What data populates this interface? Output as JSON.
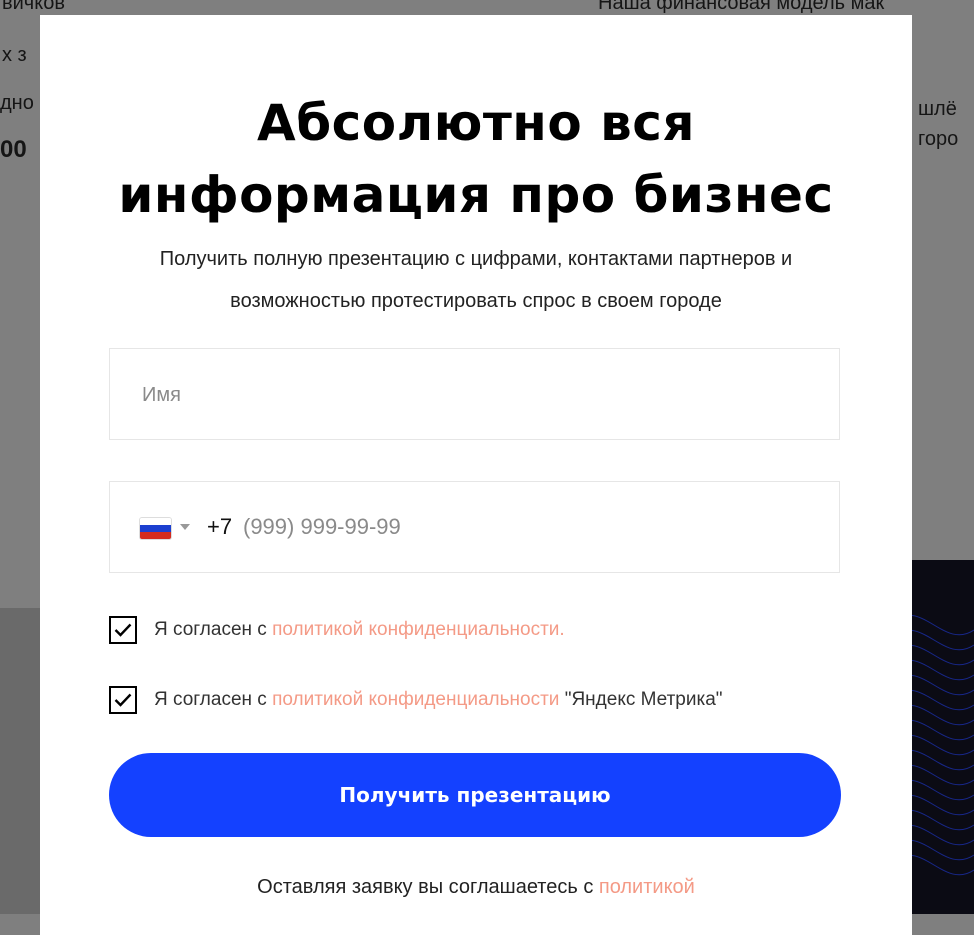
{
  "background": {
    "left_lines": [
      "вичков",
      "х з",
      "дно",
      "00 "
    ],
    "right_lines": [
      "Наша финансовая модель мак",
      "шлё",
      "горо"
    ]
  },
  "modal": {
    "title_line1": "Абсолютно вся",
    "title_line2": "информация про бизнес",
    "subtitle_line1": "Получить полную презентацию с цифрами, контактами партнеров и",
    "subtitle_line2": "возможностью протестировать спрос в своем городе",
    "name_field": {
      "placeholder": "Имя",
      "value": ""
    },
    "phone_field": {
      "country_icon": "russia-flag-icon",
      "dial_code": "+7",
      "placeholder": "(999) 999-99-99"
    },
    "consent1": {
      "checked": true,
      "prefix": "Я согласен с ",
      "link": "политикой конфиденциальности.",
      "suffix": ""
    },
    "consent2": {
      "checked": true,
      "prefix": "Я согласен с ",
      "link": "политикой конфиденциальности",
      "suffix": " \"Яндекс Метрика\""
    },
    "submit_label": "Получить презентацию",
    "footer_prefix": "Оставляя заявку вы соглашаетесь с ",
    "footer_link": "политикой"
  },
  "colors": {
    "accent": "#1441ff",
    "link": "#f49a86",
    "overlay": "#7f7f7f",
    "flag": [
      "#ffffff",
      "#1c3fd0",
      "#d52b1e"
    ]
  }
}
